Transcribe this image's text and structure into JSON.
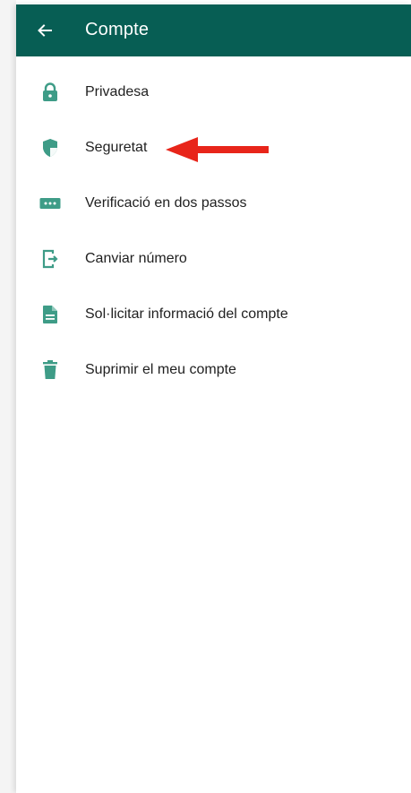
{
  "colors": {
    "appbar": "#075e54",
    "icon": "#3e9c87",
    "arrow": "#e8251a"
  },
  "appbar": {
    "title": "Compte",
    "back_icon": "arrow-left-icon"
  },
  "menu": {
    "items": [
      {
        "label": "Privadesa",
        "icon": "lock-icon"
      },
      {
        "label": "Seguretat",
        "icon": "shield-icon"
      },
      {
        "label": "Verificació en dos passos",
        "icon": "dots-password-icon"
      },
      {
        "label": "Canviar número",
        "icon": "phone-change-icon"
      },
      {
        "label": "Sol·licitar informació del compte",
        "icon": "document-icon"
      },
      {
        "label": "Suprimir el meu compte",
        "icon": "trash-icon"
      }
    ]
  }
}
